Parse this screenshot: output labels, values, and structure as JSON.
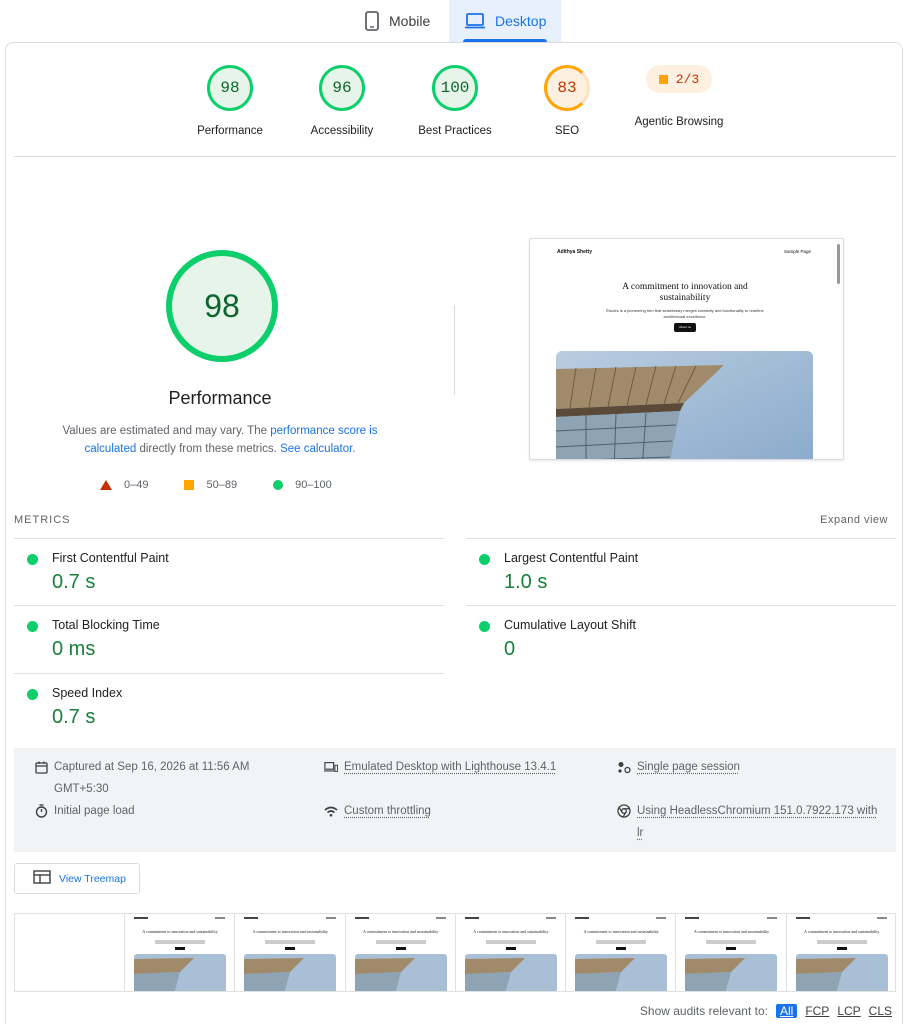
{
  "tabs": {
    "mobile": "Mobile",
    "desktop": "Desktop"
  },
  "scores": [
    {
      "value": "98",
      "label": "Performance",
      "status": "pass"
    },
    {
      "value": "96",
      "label": "Accessibility",
      "status": "pass"
    },
    {
      "value": "100",
      "label": "Best Practices",
      "status": "pass"
    },
    {
      "value": "83",
      "label": "SEO",
      "status": "average"
    }
  ],
  "agentic": {
    "value": "2/3",
    "label": "Agentic Browsing"
  },
  "performance": {
    "score": "98",
    "title": "Performance",
    "desc_1": "Values are estimated and may vary. The ",
    "desc_link_1": "performance score is calculated",
    "desc_2": " directly from these metrics. ",
    "desc_link_2": "See calculator.",
    "legend": {
      "fail": "0–49",
      "average": "50–89",
      "pass": "90–100"
    }
  },
  "screenshot": {
    "site_name": "Adithya Shetty",
    "nav_link": "Sample Page",
    "heading": "A commitment to innovation and sustainability",
    "paragraph": "Études is a pioneering firm that seamlessly merges creativity and functionality to redefine architectural excellence.",
    "button": "About us"
  },
  "metrics": {
    "heading": "METRICS",
    "expand": "Expand view",
    "fcp": {
      "name": "First Contentful Paint",
      "value": "0.7 s"
    },
    "lcp": {
      "name": "Largest Contentful Paint",
      "value": "1.0 s"
    },
    "tbt": {
      "name": "Total Blocking Time",
      "value": "0 ms"
    },
    "cls": {
      "name": "Cumulative Layout Shift",
      "value": "0"
    },
    "si": {
      "name": "Speed Index",
      "value": "0.7 s"
    }
  },
  "info": {
    "captured_1": "Captured at Sep 16, 2026 at 11:56 AM",
    "captured_2": "GMT+5:30",
    "emulated": "Emulated Desktop with Lighthouse 13.4.1",
    "session": "Single page session",
    "load": "Initial page load",
    "throttling": "Custom throttling",
    "browser_1": "Using HeadlessChromium 151.0.7922.173 with",
    "browser_2": "lr"
  },
  "treemap": "View Treemap",
  "audits": {
    "label": "Show audits relevant to:",
    "filters": [
      "All",
      "FCP",
      "LCP",
      "CLS"
    ]
  },
  "colors": {
    "pass": "#0cce6b",
    "average": "#ffa400",
    "fail": "#ff4e42",
    "link": "#1a73e8"
  }
}
